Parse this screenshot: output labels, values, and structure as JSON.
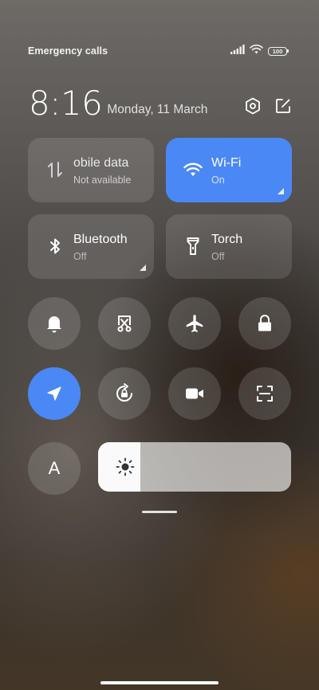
{
  "status_bar": {
    "carrier_text": "Emergency calls o",
    "battery_level": "100"
  },
  "header": {
    "time": "8:16",
    "date": "Monday, 11 March",
    "settings_icon": "settings-hexagon-icon",
    "edit_icon": "edit-icon"
  },
  "tiles": {
    "mobile_data": {
      "title": "obile data",
      "subtitle": "Not available",
      "icon": "mobile-data-icon"
    },
    "wifi": {
      "title": "Wi-Fi",
      "subtitle": "On",
      "icon": "wifi-icon",
      "active": true
    },
    "bluetooth": {
      "title": "Bluetooth",
      "subtitle": "Off",
      "icon": "bluetooth-icon"
    },
    "torch": {
      "title": "Torch",
      "subtitle": "Off",
      "icon": "torch-icon"
    }
  },
  "toggles": [
    {
      "name": "bell-icon",
      "active": false
    },
    {
      "name": "screenshot-icon",
      "active": false
    },
    {
      "name": "airplane-icon",
      "active": false
    },
    {
      "name": "lock-icon",
      "active": false
    },
    {
      "name": "location-icon",
      "active": true
    },
    {
      "name": "rotation-lock-icon",
      "active": false
    },
    {
      "name": "screen-record-icon",
      "active": false
    },
    {
      "name": "scan-icon",
      "active": false
    }
  ],
  "auto_brightness_label": "A",
  "brightness": {
    "level": 0.22,
    "icon": "sun-icon"
  },
  "colors": {
    "accent": "#4a88f6"
  }
}
